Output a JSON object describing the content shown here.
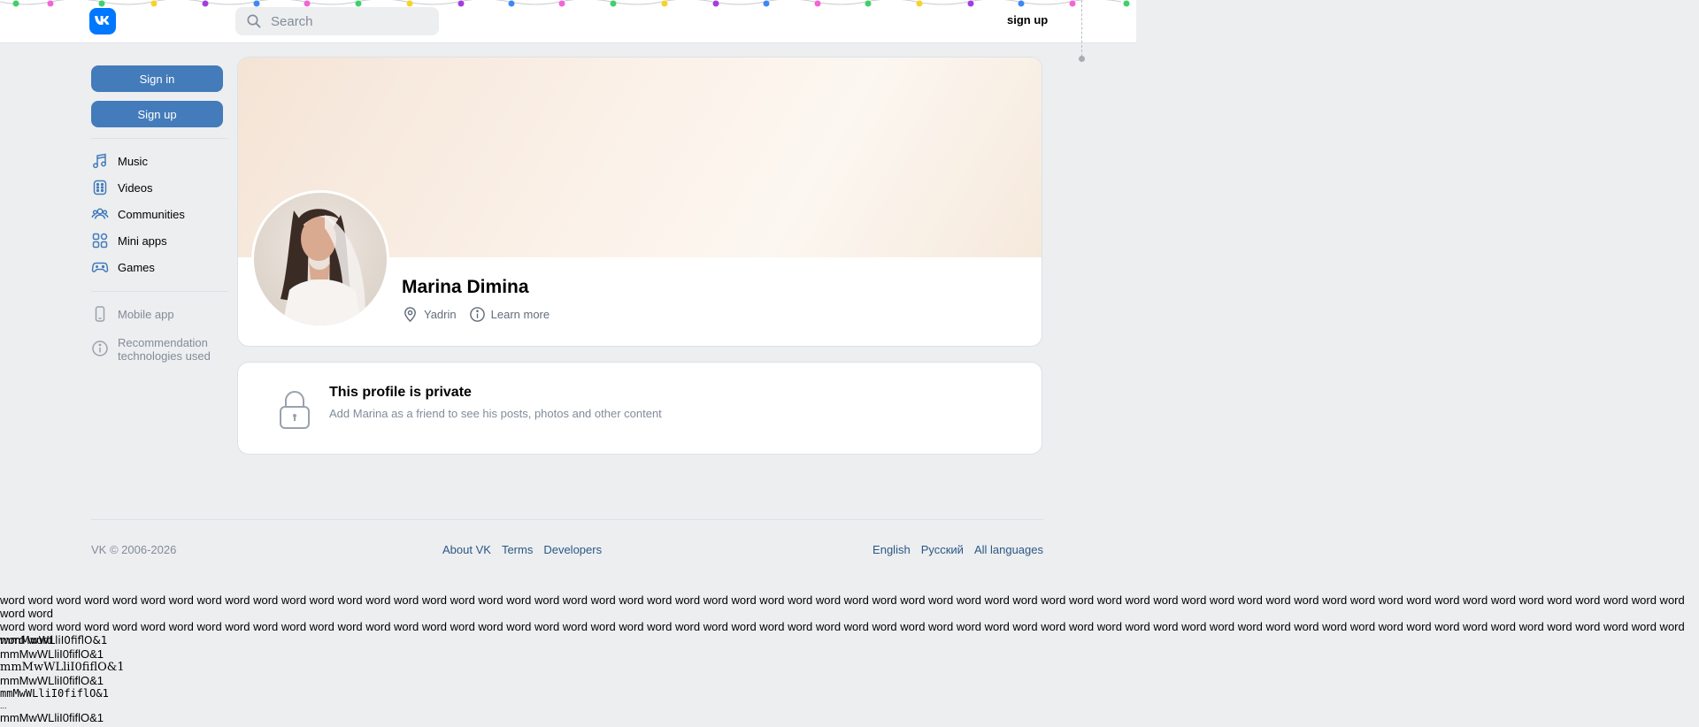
{
  "header": {
    "search_placeholder": "Search",
    "signup_link": "sign up"
  },
  "sidebar": {
    "sign_in": "Sign in",
    "sign_up": "Sign up",
    "items": [
      {
        "label": "Music",
        "icon": "music-icon"
      },
      {
        "label": "Videos",
        "icon": "video-icon"
      },
      {
        "label": "Communities",
        "icon": "users-icon"
      },
      {
        "label": "Mini apps",
        "icon": "apps-icon"
      },
      {
        "label": "Games",
        "icon": "gamepad-icon"
      }
    ],
    "mobile_app": "Mobile app",
    "recommendation_line1": "Recommendation",
    "recommendation_line2": "technologies used"
  },
  "profile": {
    "name": "Marina Dimina",
    "location": "Yadrin",
    "learn_more": "Learn more"
  },
  "private": {
    "title": "This profile is private",
    "subtitle": "Add Marina as a friend to see his posts, photos and other content"
  },
  "footer": {
    "copyright": "VK © 2006-2026",
    "links": [
      "About VK",
      "Terms",
      "Developers"
    ],
    "languages": [
      "English",
      "Русский",
      "All languages"
    ]
  },
  "test_text": {
    "words_line1": "word word word word word word word word word word word word word word word word word word word word word word word word word word word word word word word word word word word word word word word word word word word word word word word word word word word word word word word word word word word word word word",
    "words_line2": "word word word word word word word word word word word word word word word word word word word word word word word word word word word word word word word word word word word word word word word word word word word word word word word word word word word word word word word word word word word word word word",
    "font_samples": [
      "mmMwWLliI0fiflO&1",
      "mmMwWLliI0fiflO&1",
      "mmMwWLliI0fiflO&1",
      "mmMwWLliI0fiflO&1",
      "mmMwWLliI0fiflO&1"
    ],
    "dots": "...",
    "font_sample_last": "mmMwWLliI0fiflO&1"
  },
  "colors": {
    "accent": "#447bba",
    "link": "#2a5885",
    "logo": "#0077ff",
    "background": "#edeef0"
  }
}
